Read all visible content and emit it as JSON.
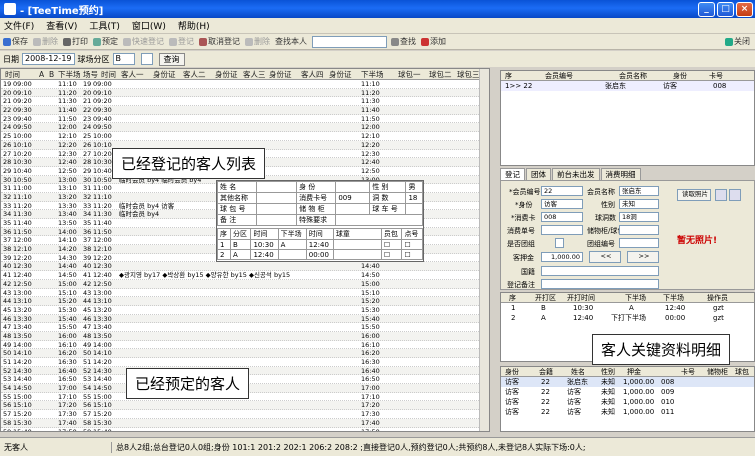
{
  "window": {
    "title": "- [TeeTime预约]"
  },
  "menu": [
    "文件(F)",
    "查看(V)",
    "工具(T)",
    "窗口(W)",
    "帮助(H)"
  ],
  "toolbar": {
    "items": [
      "保存",
      "删除",
      "打印",
      "预定",
      "快速登记",
      "登记",
      "取消登记",
      "删除",
      "查找本人"
    ],
    "find_label": "查找",
    "add_label": "添加",
    "close_label": "关闭"
  },
  "filter": {
    "date_label": "日期",
    "date_value": "2008-12-19",
    "area_label": "球场分区",
    "area_value": "B",
    "query_label": "查询"
  },
  "grid": {
    "headers": [
      "时间",
      "A",
      "B",
      "下半场",
      "场号",
      "时间",
      "客人一",
      "身份证",
      "客人二",
      "身份证",
      "客人三",
      "身份证",
      "客人四",
      "身份证",
      "下半场",
      "球包一",
      "球包二",
      "球包三"
    ],
    "rows": [
      [
        "19",
        "09:00",
        "11:10",
        "09:00",
        "",
        "11:10"
      ],
      [
        "20",
        "09:10",
        "11:20",
        "09:10",
        "",
        "11:20"
      ],
      [
        "21",
        "09:20",
        "11:30",
        "09:20",
        "",
        "11:30"
      ],
      [
        "22",
        "09:30",
        "11:40",
        "09:30",
        "",
        "11:40"
      ],
      [
        "23",
        "09:40",
        "11:50",
        "09:40",
        "",
        "11:50"
      ],
      [
        "24",
        "09:50",
        "12:00",
        "09:50",
        "",
        "12:00"
      ],
      [
        "25",
        "10:00",
        "12:10",
        "10:00",
        "",
        "12:10"
      ],
      [
        "26",
        "10:10",
        "12:20",
        "10:10",
        "",
        "12:20"
      ],
      [
        "27",
        "10:20",
        "12:30",
        "10:20",
        "",
        "12:30"
      ],
      [
        "28",
        "10:30",
        "12:40",
        "10:30",
        "",
        "12:40"
      ],
      [
        "29",
        "10:40",
        "12:50",
        "10:40",
        "",
        "12:50"
      ],
      [
        "30",
        "10:50",
        "13:00",
        "10:50",
        "临时会员 by4 临时会员 by4",
        "13:00"
      ],
      [
        "31",
        "11:00",
        "13:10",
        "11:00",
        "",
        "13:10"
      ],
      [
        "32",
        "11:10",
        "13:20",
        "11:10",
        "",
        "13:20"
      ],
      [
        "33",
        "11:20",
        "13:30",
        "11:20",
        "临时会员 by4  访客",
        "13:30"
      ],
      [
        "34",
        "11:30",
        "13:40",
        "11:30",
        "临时会员 by4",
        "13:40"
      ],
      [
        "35",
        "11:40",
        "13:50",
        "11:40",
        "",
        "13:50"
      ],
      [
        "36",
        "11:50",
        "14:00",
        "11:50",
        "",
        "14:00"
      ],
      [
        "37",
        "12:00",
        "14:10",
        "12:00",
        "",
        "14:10"
      ],
      [
        "38",
        "12:10",
        "14:20",
        "12:10",
        "",
        "14:20"
      ],
      [
        "39",
        "12:20",
        "14:30",
        "12:20",
        "",
        "14:30"
      ],
      [
        "40",
        "12:30",
        "14:40",
        "12:30",
        "",
        "14:40"
      ],
      [
        "41",
        "12:40",
        "14:50",
        "12:40",
        "◆광지영 by17  ◆박상환 by15  ◆양유한 by15  ◆신공석 by15",
        "14:50"
      ],
      [
        "42",
        "12:50",
        "15:00",
        "12:50",
        "",
        "15:00"
      ],
      [
        "43",
        "13:00",
        "15:10",
        "13:00",
        "",
        "15:10"
      ],
      [
        "44",
        "13:10",
        "15:20",
        "13:10",
        "",
        "15:20"
      ],
      [
        "45",
        "13:20",
        "15:30",
        "13:20",
        "",
        "15:30"
      ],
      [
        "46",
        "13:30",
        "15:40",
        "13:30",
        "",
        "15:40"
      ],
      [
        "47",
        "13:40",
        "15:50",
        "13:40",
        "",
        "15:50"
      ],
      [
        "48",
        "13:50",
        "16:00",
        "13:50",
        "",
        "16:00"
      ],
      [
        "49",
        "14:00",
        "16:10",
        "14:00",
        "",
        "16:10"
      ],
      [
        "50",
        "14:10",
        "16:20",
        "14:10",
        "",
        "16:20"
      ],
      [
        "51",
        "14:20",
        "16:30",
        "14:20",
        "",
        "16:30"
      ],
      [
        "52",
        "14:30",
        "16:40",
        "14:30",
        "",
        "16:40"
      ],
      [
        "53",
        "14:40",
        "16:50",
        "14:40",
        "",
        "16:50"
      ],
      [
        "54",
        "14:50",
        "17:00",
        "14:50",
        "",
        "17:00"
      ],
      [
        "55",
        "15:00",
        "17:10",
        "15:00",
        "",
        "17:10"
      ],
      [
        "56",
        "15:10",
        "17:20",
        "15:10",
        "",
        "17:20"
      ],
      [
        "57",
        "15:20",
        "17:30",
        "15:20",
        "",
        "17:30"
      ],
      [
        "58",
        "15:30",
        "17:40",
        "15:30",
        "",
        "17:40"
      ],
      [
        "59",
        "15:40",
        "17:50",
        "15:40",
        "",
        "17:50"
      ]
    ]
  },
  "popup": {
    "r1": [
      "姓 名",
      "",
      "身 份",
      "",
      "性 别",
      "男"
    ],
    "r2": [
      "其他名称",
      "",
      "消费卡号",
      "009",
      "洞 数",
      "18"
    ],
    "r3": [
      "球 包 号",
      "",
      "储 物 柜",
      "",
      "球 车 号",
      ""
    ],
    "r4": [
      "备 注",
      "",
      "特殊要求",
      ""
    ],
    "sub_headers": [
      "序",
      "分区",
      "时间",
      "下半场",
      "时间",
      "球童",
      "员包",
      "点号"
    ],
    "sub_rows": [
      [
        "1",
        "B",
        "10:30",
        "A",
        "12:40"
      ],
      [
        "2",
        "A",
        "12:40",
        "",
        "00:00"
      ]
    ]
  },
  "callouts": {
    "registered": "已经登记的客人列表",
    "reserved": "已经预定的客人",
    "detail": "客人关键资料明细"
  },
  "top_list": {
    "headers": [
      "序",
      "会员编号",
      "会员名称",
      "身份",
      "卡号"
    ],
    "rows": [
      [
        "1>> 22",
        "",
        "张启东",
        "访客",
        "008"
      ]
    ]
  },
  "tabs": [
    "登记",
    "团体",
    "前台未出发",
    "消费明细"
  ],
  "form": {
    "member_no_label": "*会员编号",
    "member_no": "22",
    "member_name_label": "会员名称",
    "member_name": "张启东",
    "identity_label": "*身份",
    "identity": "访客",
    "gender_label": "性别",
    "gender": "未知",
    "card_label": "*消费卡",
    "card": "008",
    "holes_label": "球洞数",
    "holes": "18洞",
    "bill_label": "消费单号",
    "locker_label": "储物柜/球包",
    "vip_label": "是否团组",
    "group_label": "团组编号",
    "deposit_label": "客押金",
    "deposit": "1,000.00",
    "country_label": "国籍",
    "note_label": "登记备注",
    "photo_label": "读取照片",
    "no_photo": "暂无照片!",
    "prev": "<<",
    "next": ">>"
  },
  "tee_list": {
    "headers": [
      "序",
      "开打区",
      "开打时间",
      "下半场",
      "下半场",
      "操作员"
    ],
    "rows": [
      [
        "1",
        "B",
        "10:30",
        "A",
        "12:40",
        "gzt"
      ],
      [
        "2",
        "A",
        "12:40",
        "下打下半场",
        "00:00",
        "gzt"
      ]
    ]
  },
  "bottom_list": {
    "headers": [
      "身份",
      "会籍",
      "姓名",
      "性别",
      "押金",
      "卡号",
      "储物柜",
      "球包"
    ],
    "rows": [
      [
        "访客",
        "22",
        "张启东",
        "未知",
        "1,000.00",
        "008"
      ],
      [
        "访客",
        "22",
        "访客",
        "未知",
        "1,000.00",
        "009"
      ],
      [
        "访客",
        "22",
        "访客",
        "未知",
        "1,000.00",
        "010"
      ],
      [
        "访客",
        "22",
        "访客",
        "未知",
        "1,000.00",
        "011"
      ]
    ]
  },
  "status": {
    "left": "无客人",
    "right": "总8人2组;总台登记0人0组;身份 101:1 201:2 202:1 206:2 208:2 ;直接登记0人,预约登记0人;共预约8人,未登记8人实际下场:0人;"
  }
}
